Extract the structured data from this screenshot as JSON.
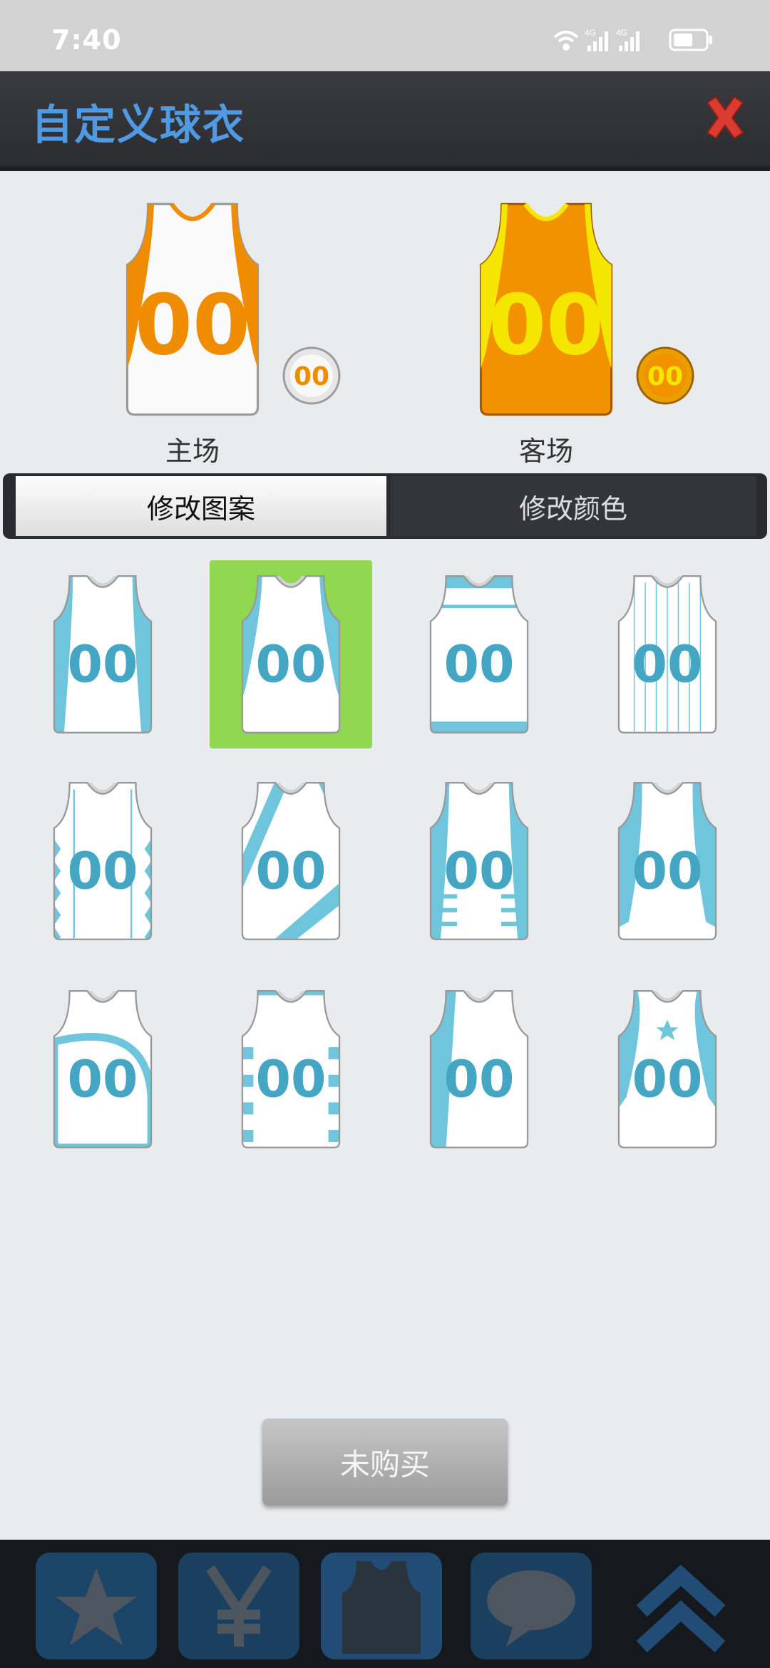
{
  "status_bar": {
    "time": "7:40",
    "network_1": "4G",
    "network_2": "4G"
  },
  "header": {
    "title": "自定义球衣"
  },
  "preview": {
    "home": {
      "label": "主场",
      "number": "00",
      "body_color": "#fafafa",
      "accent_color": "#f08c00"
    },
    "away": {
      "label": "客场",
      "number": "00",
      "body_color": "#f39200",
      "accent_color": "#f5e600"
    }
  },
  "tabs": {
    "pattern_label": "修改图案",
    "color_label": "修改颜色"
  },
  "grid": {
    "number": "00",
    "number_color": "#45a6c4",
    "accent_color": "#6fc6dc",
    "selected_index": 1
  },
  "buy_button": {
    "label": "未购买"
  },
  "colors": {
    "selected_bg": "#8fd84f",
    "title_blue": "#4f9ae2",
    "close_red": "#d93b2f"
  }
}
